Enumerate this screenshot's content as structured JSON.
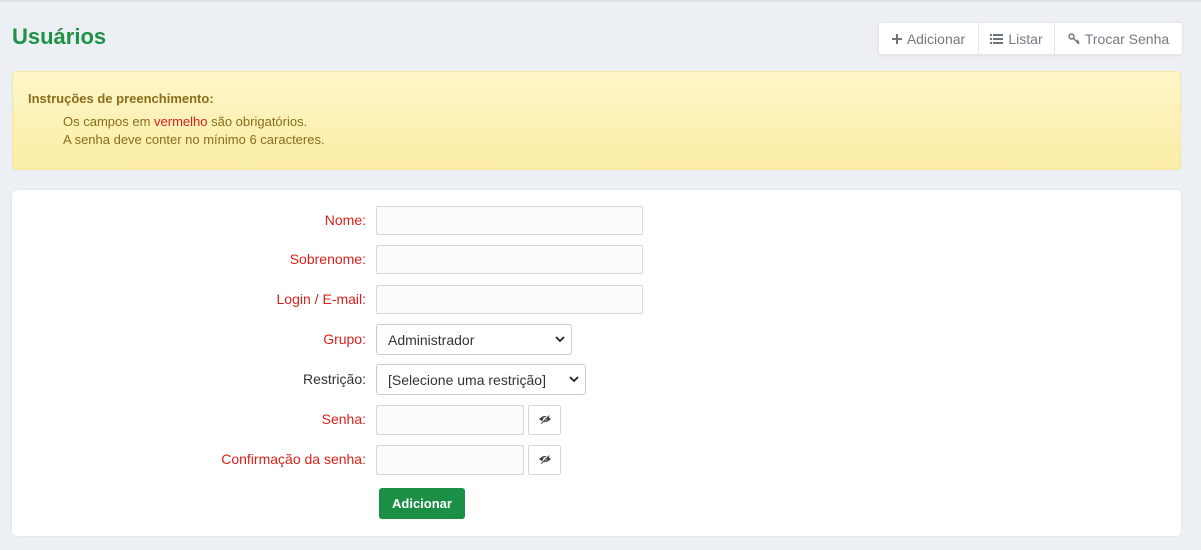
{
  "page": {
    "title": "Usuários"
  },
  "actions": [
    {
      "label": "Adicionar",
      "icon": "plus-icon"
    },
    {
      "label": "Listar",
      "icon": "list-icon"
    },
    {
      "label": "Trocar Senha",
      "icon": "key-icon"
    }
  ],
  "instructions": {
    "title": "Instruções de preenchimento:",
    "line1_prefix": "Os campos em ",
    "line1_highlight": "vermelho",
    "line1_suffix": " são obrigatórios.",
    "line2": "A senha deve conter no mínimo 6 caracteres."
  },
  "form": {
    "nome_label": "Nome:",
    "nome_value": "",
    "sobrenome_label": "Sobrenome:",
    "sobrenome_value": "",
    "login_label": "Login / E-mail:",
    "login_value": "",
    "grupo_label": "Grupo:",
    "grupo_value": "Administrador",
    "restricao_label": "Restrição:",
    "restricao_value": "[Selecione uma restrição]",
    "senha_label": "Senha:",
    "senha_value": "",
    "confirmacao_label": "Confirmação da senha:",
    "confirmacao_value": "",
    "submit_label": "Adicionar"
  },
  "colors": {
    "title": "#1e9246",
    "required_label": "#d9211c",
    "alert_text": "#8a6d1a",
    "alert_bg": "#fbeda6",
    "submit_bg": "#1b8f45"
  }
}
